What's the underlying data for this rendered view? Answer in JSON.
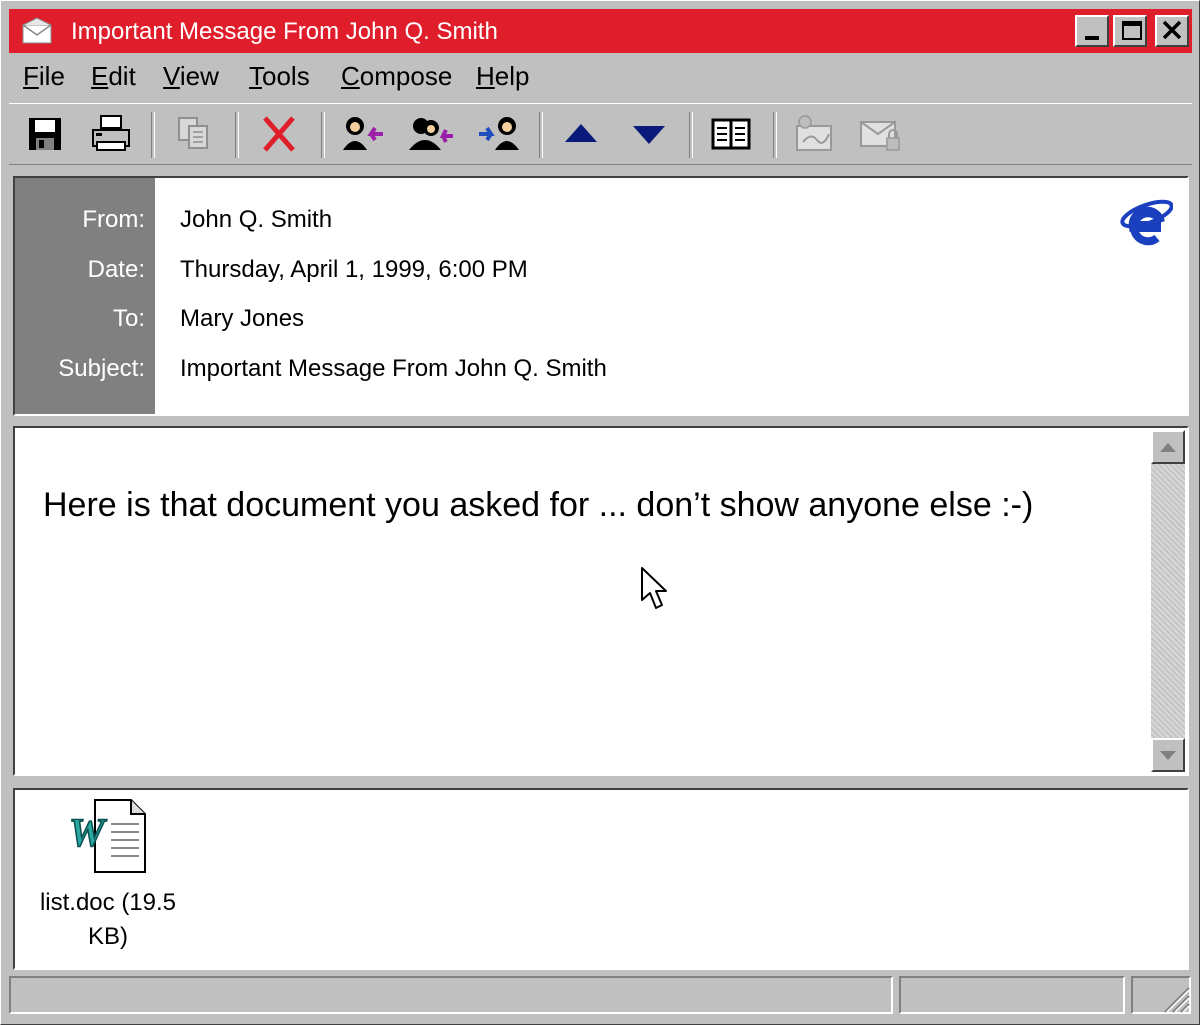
{
  "window": {
    "title": "Important Message From John Q. Smith",
    "title_bar_color": "#e01e2b"
  },
  "menu": {
    "items": [
      {
        "key": "F",
        "rest": "ile"
      },
      {
        "key": "E",
        "rest": "dit"
      },
      {
        "key": "V",
        "rest": "iew"
      },
      {
        "key": "T",
        "rest": "ools"
      },
      {
        "key": "C",
        "rest": "ompose"
      },
      {
        "key": "H",
        "rest": "elp"
      }
    ]
  },
  "toolbar": {
    "icons": [
      "save-icon",
      "print-icon",
      "copy-icon",
      "delete-icon",
      "reply-icon",
      "reply-all-icon",
      "forward-icon",
      "previous-icon",
      "next-icon",
      "address-book-icon",
      "sign-icon",
      "encrypt-icon"
    ]
  },
  "header": {
    "from_label": "From:",
    "from_value": "John Q. Smith",
    "date_label": "Date:",
    "date_value": "Thursday, April 1, 1999, 6:00 PM",
    "to_label": "To:",
    "to_value": "Mary Jones",
    "subject_label": "Subject:",
    "subject_value": "Important Message From John Q. Smith"
  },
  "body": {
    "text": "Here is that document you asked for ... don’t show anyone else :-)"
  },
  "attachment": {
    "label": "list.doc (19.5 KB)",
    "icon": "word-document-icon"
  }
}
